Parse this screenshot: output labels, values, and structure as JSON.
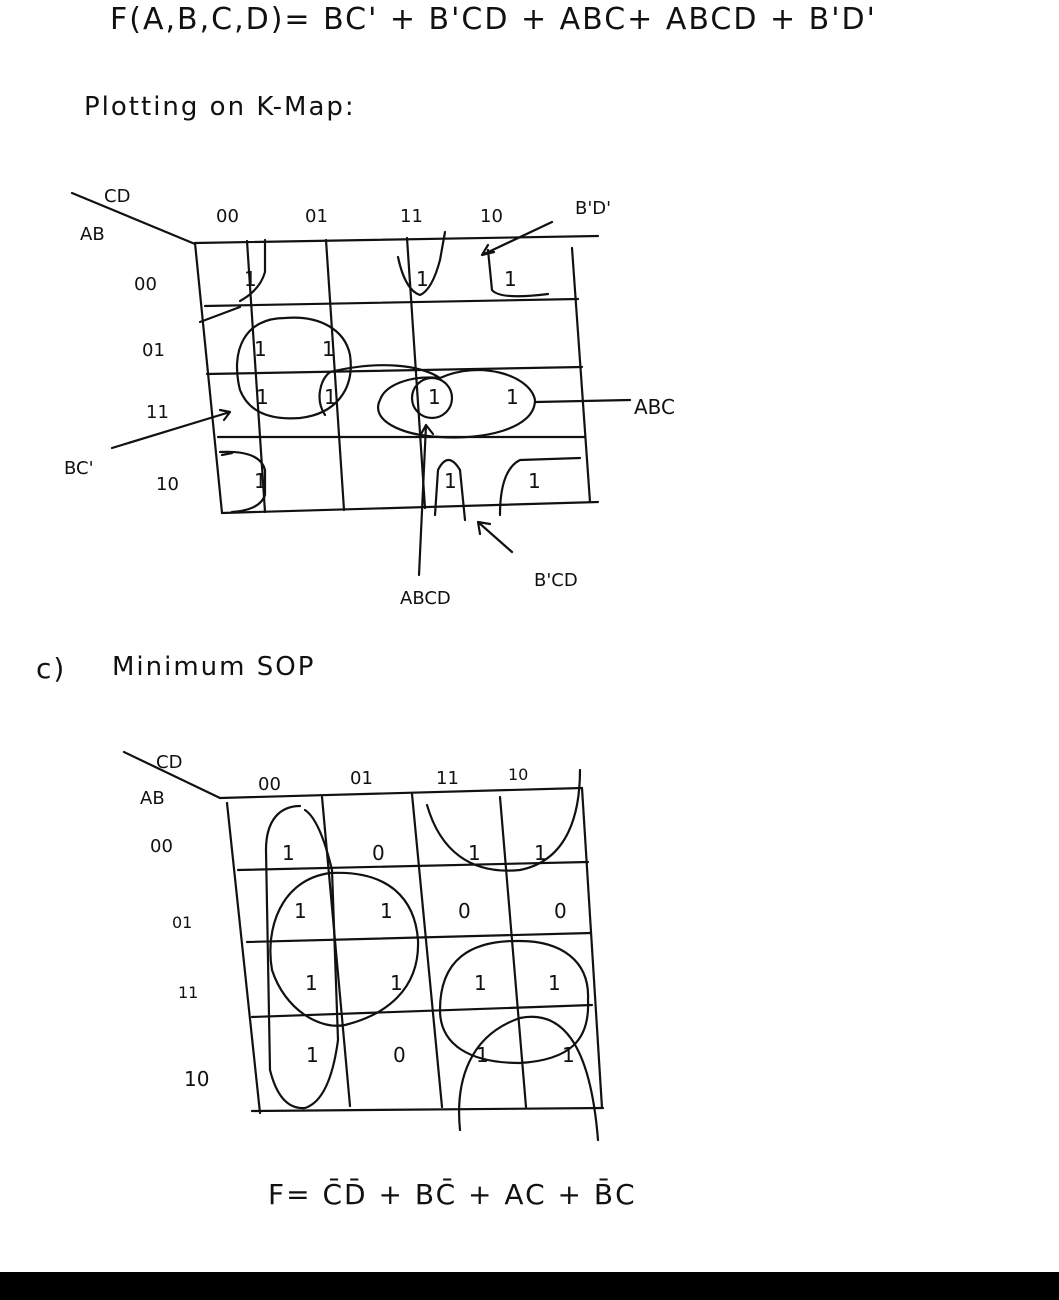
{
  "equation": "F(A,B,C,D)= BC' + B'CD + ABC+ ABCD + B'D'",
  "plotting_heading": "Plotting on K-Map:",
  "kmap1": {
    "corner_top": "CD",
    "corner_left": "AB",
    "col_labels": [
      "00",
      "01",
      "11",
      "10"
    ],
    "row_labels": [
      "00",
      "01",
      "11",
      "10"
    ],
    "cells": [
      [
        "1",
        "",
        "1",
        "1"
      ],
      [
        "1",
        "1",
        "",
        ""
      ],
      [
        "1",
        "1",
        "1",
        "1"
      ],
      [
        "1",
        "",
        "1",
        "1"
      ]
    ],
    "annotations": {
      "bd": "B'D'",
      "abc": "ABC",
      "bc": "BC'",
      "abcd": "ABCD",
      "bcd": "B'CD"
    }
  },
  "section_c": {
    "label": "c)",
    "title": "Minimum SOP"
  },
  "kmap2": {
    "corner_top": "CD",
    "corner_left": "AB",
    "col_labels": [
      "00",
      "01",
      "11",
      "10"
    ],
    "row_labels": [
      "00",
      "01",
      "11",
      "10"
    ],
    "cells": [
      [
        "1",
        "0",
        "1",
        "1"
      ],
      [
        "1",
        "1",
        "0",
        "0"
      ],
      [
        "1",
        "1",
        "1",
        "1"
      ],
      [
        "1",
        "0",
        "1",
        "1"
      ]
    ]
  },
  "result": {
    "prefix": "F=",
    "terms": [
      {
        "text": "C̄D̄"
      },
      {
        "text": "BC̄"
      },
      {
        "text": "AC"
      },
      {
        "text": "B̄C"
      }
    ],
    "joiner": " + "
  }
}
